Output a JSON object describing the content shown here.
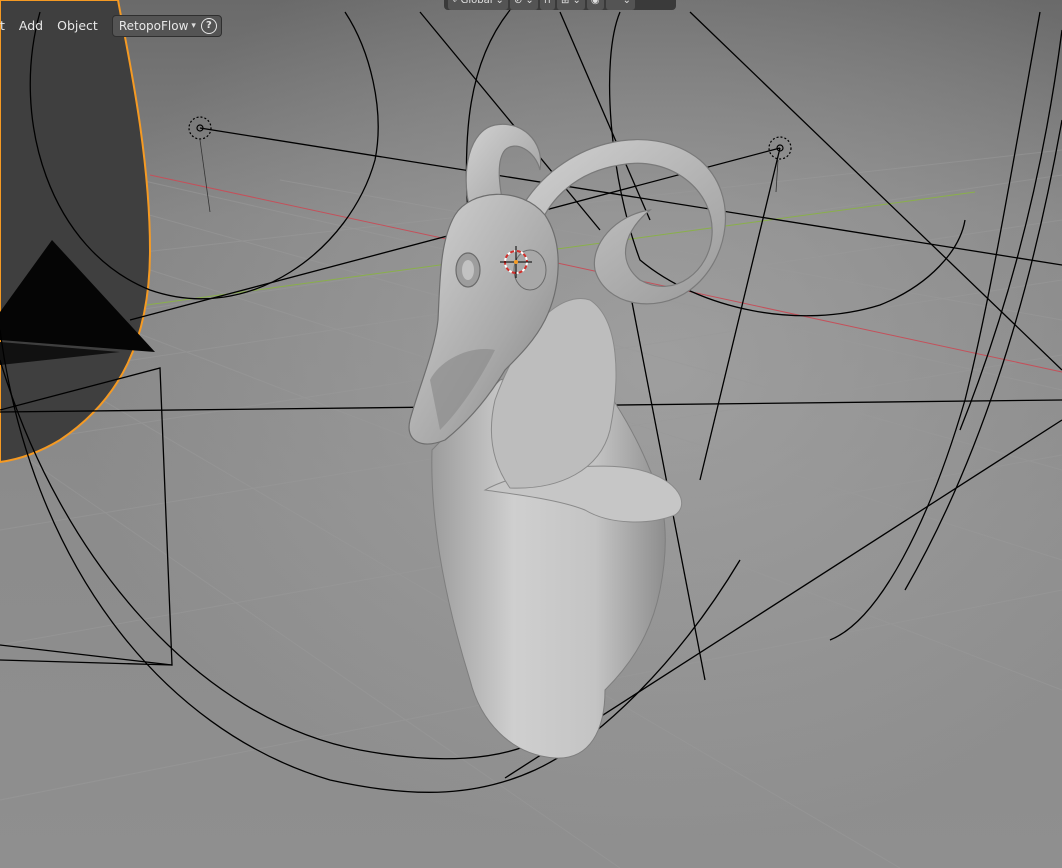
{
  "header": {
    "menu": [
      {
        "label": "t"
      },
      {
        "label": "Add"
      },
      {
        "label": "Object"
      }
    ],
    "addon_dropdown": "RetopoFlow",
    "help_glyph": "?"
  },
  "top_toolbar": {
    "transform_orientation": "Global",
    "icons": [
      "orientation-icon",
      "pivot-icon",
      "snap-icon",
      "snap-increment-icon",
      "proportional-edit-icon",
      "falloff-icon"
    ]
  },
  "colors": {
    "viewport_bg": "#7f7f7f",
    "grid_line": "#8a8a8a",
    "x_axis": "#c4505a",
    "y_axis": "#8ab04a",
    "selected_outline": "#f59a23",
    "wire": "#000000",
    "model": "#bdbdbd"
  }
}
